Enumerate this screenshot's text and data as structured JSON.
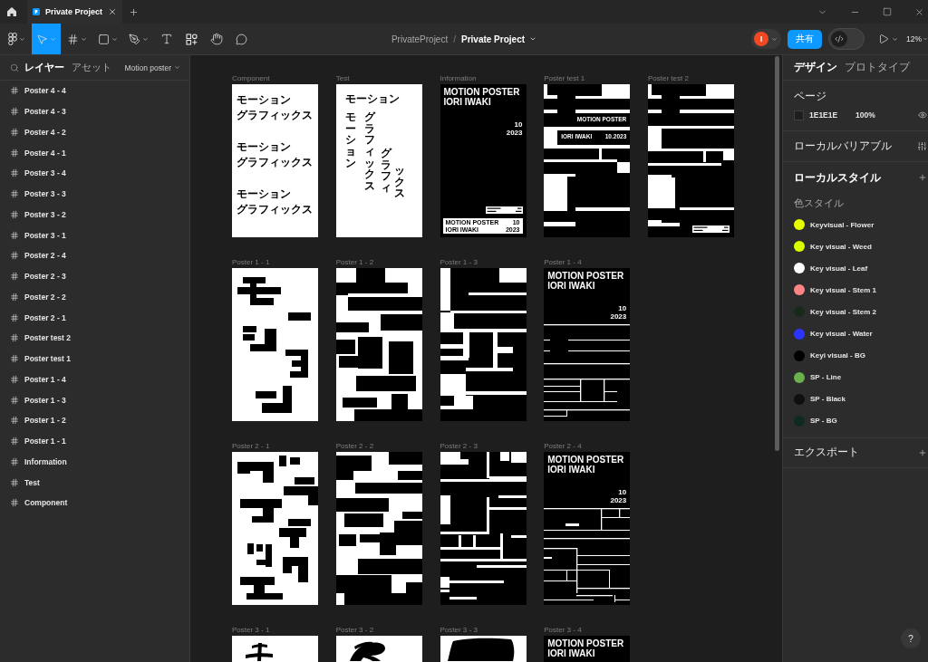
{
  "title_bar": {
    "tabs": [
      {
        "label": "Private Project",
        "selected": true
      }
    ]
  },
  "toolbar": {
    "tools": [
      {
        "kind": "main-menu",
        "dropdown": true,
        "selected": false
      },
      {
        "kind": "move",
        "dropdown": true,
        "selected": true
      },
      {
        "kind": "frame",
        "dropdown": true,
        "selected": false
      },
      {
        "kind": "shape",
        "dropdown": true,
        "selected": false
      },
      {
        "kind": "pen",
        "dropdown": true,
        "selected": false
      },
      {
        "kind": "text",
        "dropdown": false,
        "selected": false
      },
      {
        "kind": "resources",
        "dropdown": false,
        "selected": false
      },
      {
        "kind": "hand",
        "dropdown": false,
        "selected": false
      },
      {
        "kind": "comment",
        "dropdown": false,
        "selected": false
      }
    ],
    "breadcrumb": {
      "project": "PrivateProject",
      "separator": "/",
      "file": "Private Project"
    },
    "avatar": "I",
    "share_button": "共有",
    "dev_mode": {
      "on": false
    },
    "zoom": "12%"
  },
  "layers_panel": {
    "tabs": [
      {
        "label": "レイヤー",
        "selected": true
      },
      {
        "label": "アセット",
        "selected": false
      }
    ],
    "page": "Motion poster",
    "layers": [
      {
        "name": "Poster 4 - 4",
        "selected": false
      },
      {
        "name": "Poster 4 - 3",
        "selected": false
      },
      {
        "name": "Poster 4 - 2",
        "selected": false
      },
      {
        "name": "Poster 4 - 1",
        "selected": false
      },
      {
        "name": "Poster 3 - 4",
        "selected": false
      },
      {
        "name": "Poster 3 - 3",
        "selected": false
      },
      {
        "name": "Poster 3 - 2",
        "selected": false
      },
      {
        "name": "Poster 3 - 1",
        "selected": false
      },
      {
        "name": "Poster 2 - 4",
        "selected": false
      },
      {
        "name": "Poster 2 - 3",
        "selected": false
      },
      {
        "name": "Poster 2 - 2",
        "selected": false
      },
      {
        "name": "Poster 2 - 1",
        "selected": false
      },
      {
        "name": "Poster test 2",
        "selected": false
      },
      {
        "name": "Poster test 1",
        "selected": false
      },
      {
        "name": "Poster 1 - 4",
        "selected": false
      },
      {
        "name": "Poster 1 - 3",
        "selected": false
      },
      {
        "name": "Poster 1 - 2",
        "selected": false
      },
      {
        "name": "Poster 1 - 1",
        "selected": false
      },
      {
        "name": "Information",
        "selected": false
      },
      {
        "name": "Test",
        "selected": false
      },
      {
        "name": "Component",
        "selected": false
      }
    ]
  },
  "canvas": {
    "rows": [
      {
        "frames": [
          {
            "label": "Component",
            "kind": "type-stack",
            "groups": [
              [
                "モーション",
                "グラフィックス"
              ],
              [
                "モーション",
                "グラフィックス"
              ],
              [
                "モーション",
                "グラフィックス"
              ]
            ]
          },
          {
            "label": "Test",
            "kind": "type-vertical",
            "heading": "モーション",
            "columns": [
              "モーション",
              "グラフィックス",
              "グラフィ",
              "ックス"
            ]
          },
          {
            "label": "Information",
            "kind": "title-card",
            "title": "MOTION POSTER",
            "author": "IORI IWAKI",
            "month": "10",
            "year": "2023",
            "footer": {
              "title": "MOTION POSTER",
              "month": "10",
              "author": "IORI IWAKI",
              "year": "2023"
            }
          },
          {
            "label": "Poster test 1",
            "kind": "block-test",
            "title": "MOTION POSTER",
            "author": "IORI IWAKI",
            "date": "10.2023"
          },
          {
            "label": "Poster test 2",
            "kind": "block-test"
          }
        ]
      },
      {
        "frames": [
          {
            "label": "Poster 1 - 1",
            "kind": "lettering"
          },
          {
            "label": "Poster 1 - 2",
            "kind": "lettering"
          },
          {
            "label": "Poster 1 - 3",
            "kind": "lettering"
          },
          {
            "label": "Poster 1 - 4",
            "kind": "title-lines",
            "title": "MOTION POSTER",
            "author": "IORI IWAKI",
            "month": "10",
            "year": "2023"
          }
        ]
      },
      {
        "frames": [
          {
            "label": "Poster 2 - 1",
            "kind": "lettering"
          },
          {
            "label": "Poster 2 - 2",
            "kind": "lettering"
          },
          {
            "label": "Poster 2 - 3",
            "kind": "lettering"
          },
          {
            "label": "Poster 2 - 4",
            "kind": "title-lines",
            "title": "MOTION POSTER",
            "author": "IORI IWAKI",
            "month": "10",
            "year": "2023"
          }
        ]
      },
      {
        "frames": [
          {
            "label": "Poster 3 - 1",
            "kind": "brush"
          },
          {
            "label": "Poster 3 - 2",
            "kind": "brush"
          },
          {
            "label": "Poster 3 - 3",
            "kind": "brush"
          },
          {
            "label": "Poster 3 - 4",
            "kind": "title-lines",
            "title": "MOTION POSTER",
            "author": "IORI IWAKI"
          }
        ]
      }
    ]
  },
  "design_panel": {
    "tabs": [
      {
        "label": "デザイン",
        "selected": true
      },
      {
        "label": "プロトタイプ",
        "selected": false
      }
    ],
    "page": {
      "title": "ページ",
      "fill": "1E1E1E",
      "opacity": "100%"
    },
    "variables": "ローカルバリアブル",
    "styles": {
      "title": "ローカルスタイル",
      "group": "色スタイル",
      "colors": [
        {
          "name": "Keyvisual - Flower",
          "color": "#e5ff00"
        },
        {
          "name": "Key visual - Weed",
          "color": "#dcff00"
        },
        {
          "name": "Key visual - Leaf",
          "color": "#ffffff"
        },
        {
          "name": "Key visual - Stem 1",
          "color": "#ff8585"
        },
        {
          "name": "Key visual - Stem 2",
          "color": "#1a2a1a"
        },
        {
          "name": "Key visual - Water",
          "color": "#2b35ff"
        },
        {
          "name": "Keyi visual - BG",
          "color": "#000000"
        },
        {
          "name": "SP - Line",
          "color": "#6ab04c"
        },
        {
          "name": "SP - Black",
          "color": "#0f0f0f"
        },
        {
          "name": "SP - BG",
          "color": "#0f2a20"
        }
      ]
    },
    "export": "エクスポート",
    "help": "?"
  }
}
